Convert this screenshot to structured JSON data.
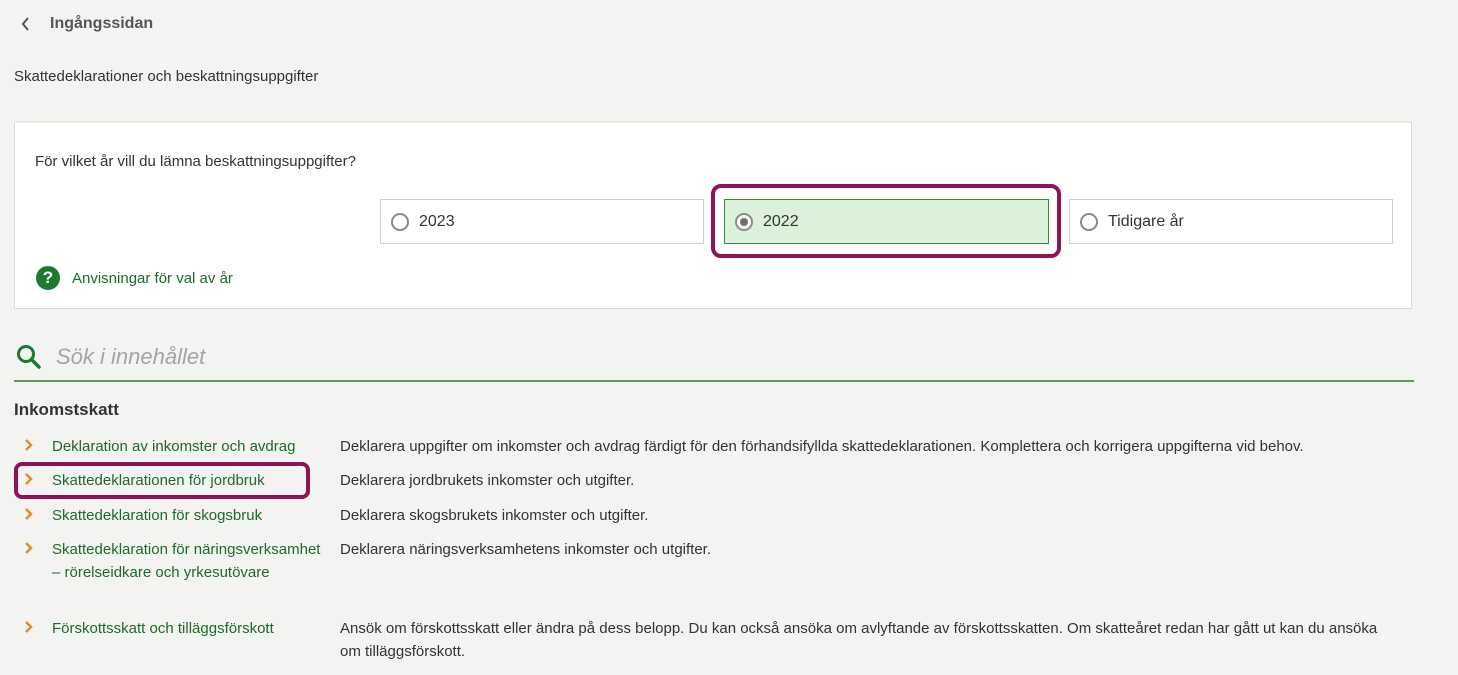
{
  "back": {
    "label": "Ingångssidan"
  },
  "page_title": "Skattedeklarationer och beskattningsuppgifter",
  "year_selector": {
    "question": "För vilket år vill du lämna beskattningsuppgifter?",
    "options": [
      {
        "label": "2023",
        "selected": false
      },
      {
        "label": "2022",
        "selected": true
      },
      {
        "label": "Tidigare år",
        "selected": false
      }
    ],
    "help_link": "Anvisningar för val av år"
  },
  "search": {
    "placeholder": "Sök i innehållet"
  },
  "section": {
    "title": "Inkomstskatt",
    "items": [
      {
        "link": "Deklaration av inkomster och avdrag",
        "description": "Deklarera uppgifter om inkomster och avdrag färdigt för den förhandsifyllda skattedeklarationen. Komplettera och korrigera uppgifterna vid behov."
      },
      {
        "link": "Skattedeklarationen för jordbruk",
        "description": "Deklarera jordbrukets inkomster och utgifter."
      },
      {
        "link": "Skattedeklaration för skogsbruk",
        "description": "Deklarera skogsbrukets inkomster och utgifter."
      },
      {
        "link": "Skattedeklaration för näringsverksamhet – rörelseidkare och yrkesutövare",
        "description": "Deklarera näringsverksamhetens inkomster och utgifter."
      },
      {
        "link": "Förskottsskatt och tilläggsförskott",
        "description": "Ansök om förskottsskatt eller ändra på dess belopp. Du kan också ansöka om avlyftande av förskottsskatten. Om skatteåret redan har gått ut kan du ansöka om tilläggsförskott."
      }
    ]
  },
  "colors": {
    "link_green": "#1e6a2b",
    "selected_bg": "#dcf1d9",
    "highlight": "#8e1357",
    "chevron_orange": "#e8892b"
  },
  "icons": {
    "back": "chevron-left-icon",
    "help": "question-circle-icon",
    "search": "search-icon",
    "item": "chevron-right-icon"
  }
}
